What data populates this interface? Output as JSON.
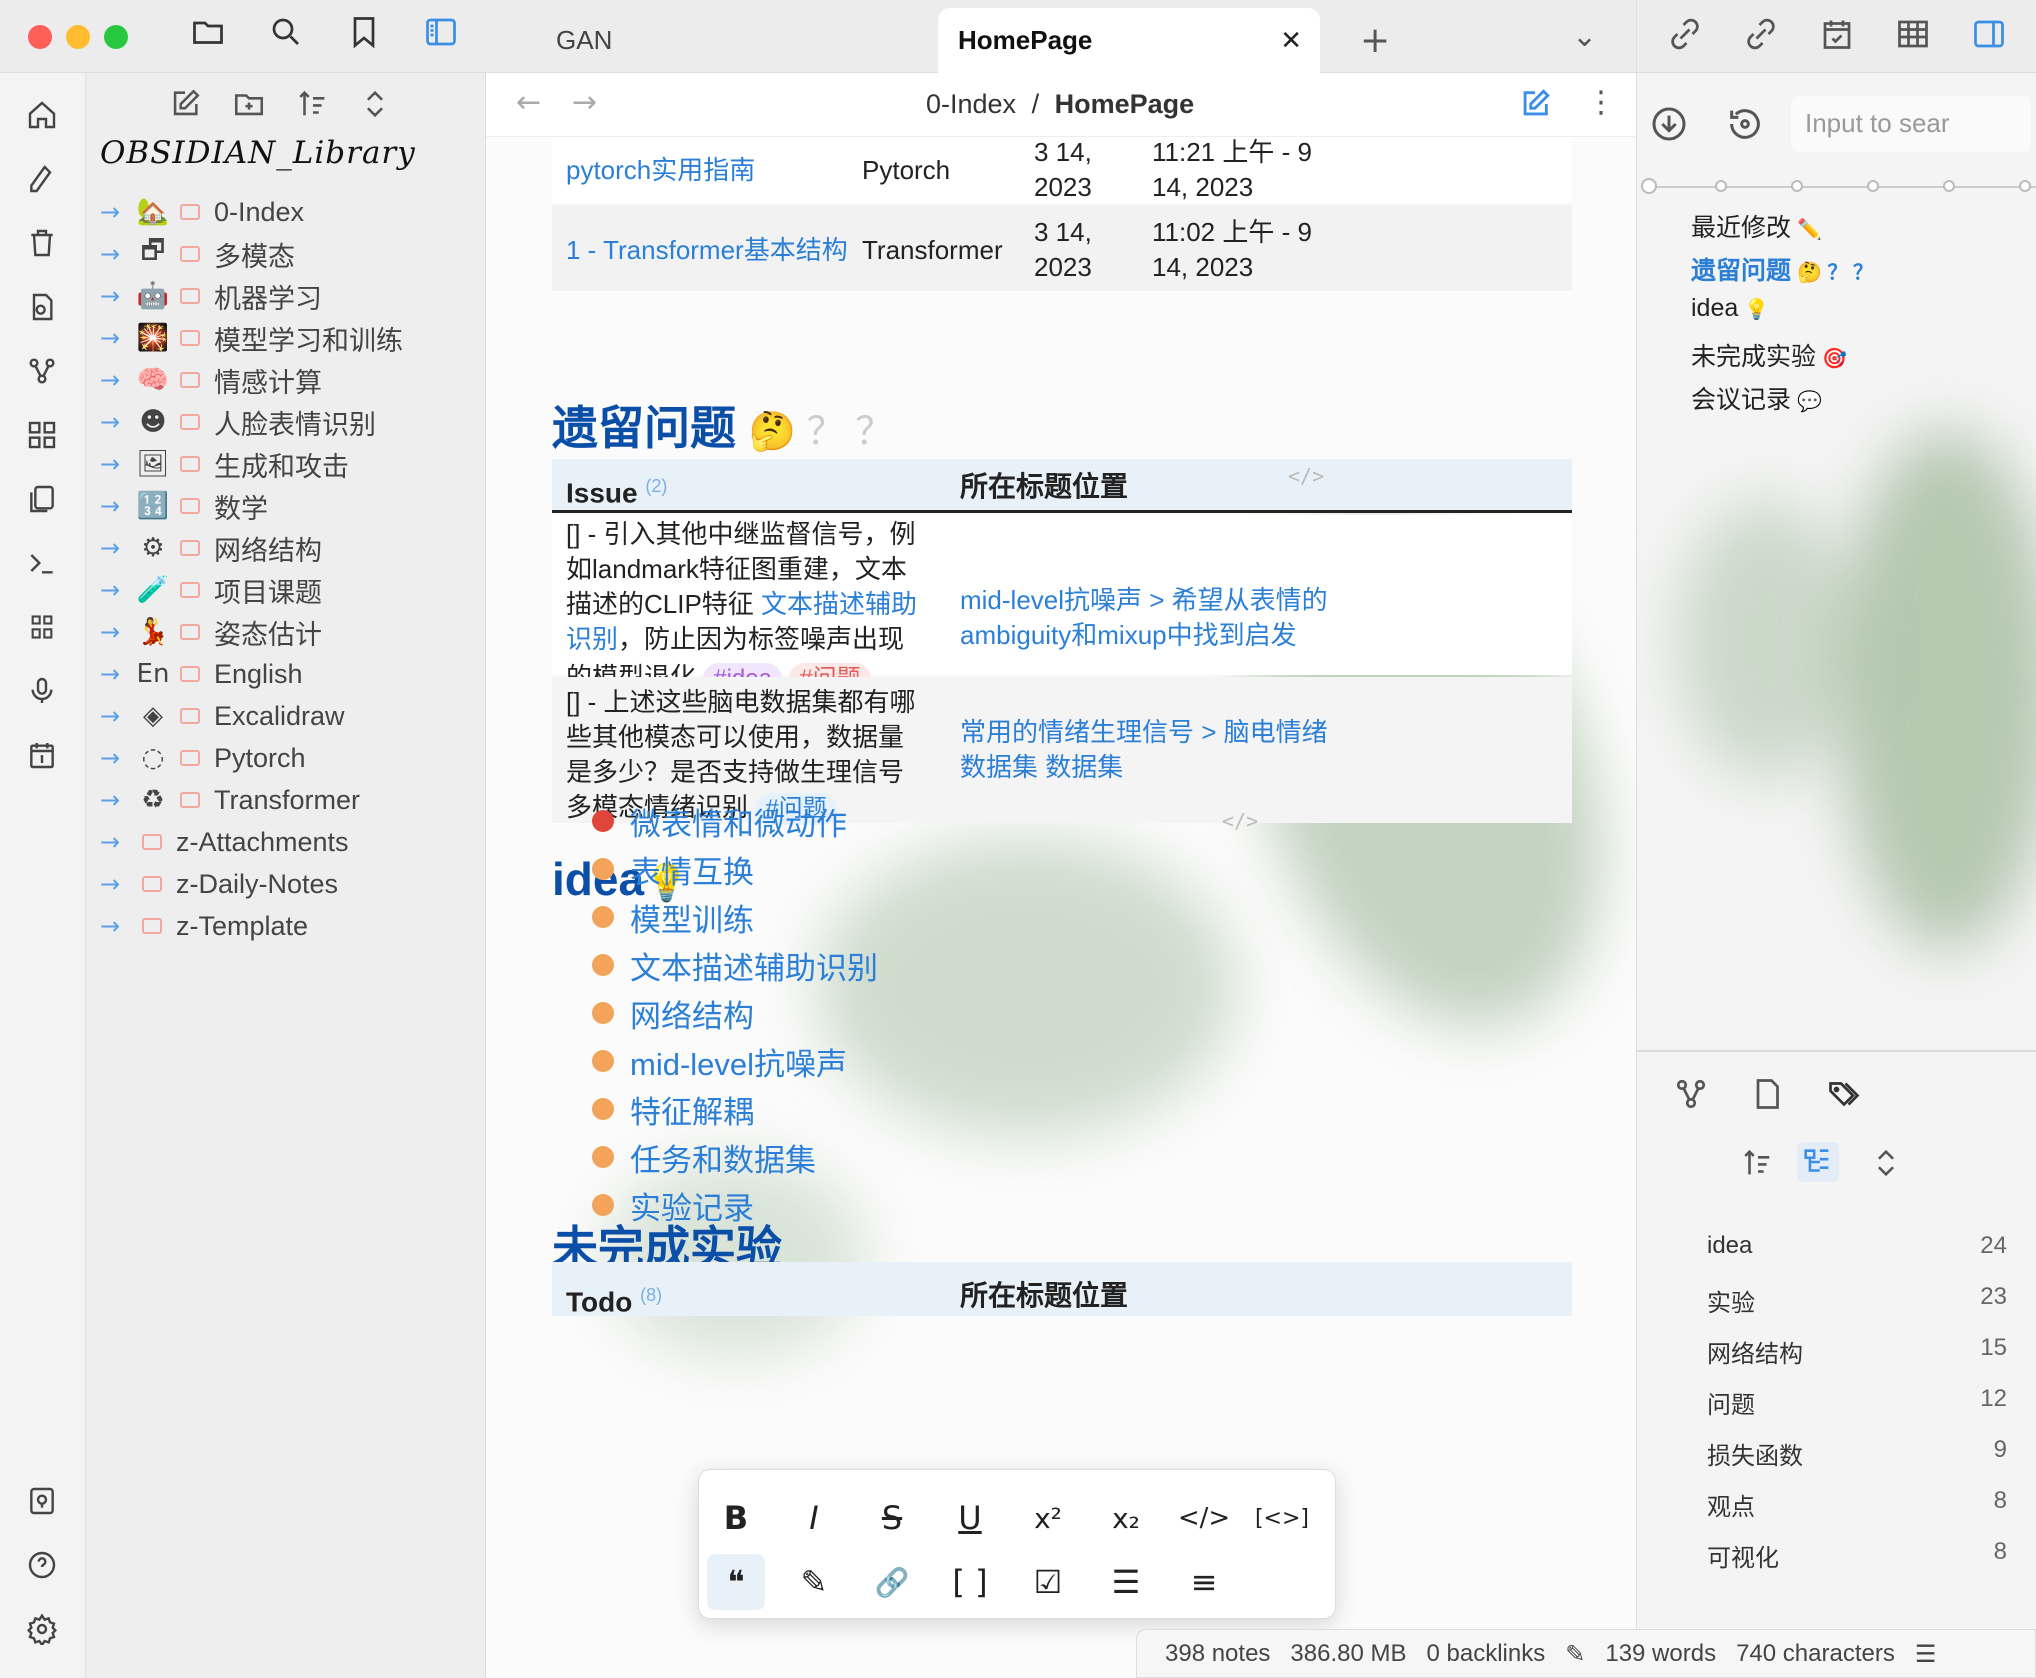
{
  "left_toolbar": {
    "icons": [
      "folder-icon",
      "search-icon",
      "bookmark-icon",
      "sidebar-toggle-icon"
    ],
    "file_actions": [
      "new-note-icon",
      "new-folder-icon",
      "sort-icon",
      "collapse-icon"
    ]
  },
  "ribbon": {
    "icons": [
      "home-icon",
      "pen-icon",
      "trash-icon",
      "file-search-icon",
      "graph-icon",
      "grid-icon",
      "pages-icon",
      "terminal-icon",
      "calendar-grid-icon",
      "mic-icon",
      "calendar-icon",
      "vault-icon",
      "help-icon",
      "settings-icon"
    ]
  },
  "vault_name": "OBSIDIAN_Library",
  "tree": [
    {
      "emoji": "🏡",
      "label": "0-Index"
    },
    {
      "emoji": "🗗",
      "label": "多模态"
    },
    {
      "emoji": "🤖",
      "label": "机器学习"
    },
    {
      "emoji": "🎇",
      "label": "模型学习和训练"
    },
    {
      "emoji": "🧠",
      "label": "情感计算"
    },
    {
      "emoji": "☻",
      "label": "人脸表情识别"
    },
    {
      "emoji": "🖼",
      "label": "生成和攻击"
    },
    {
      "emoji": "🔢",
      "label": "数学"
    },
    {
      "emoji": "⚙",
      "label": "网络结构"
    },
    {
      "emoji": "🧪",
      "label": "项目课题"
    },
    {
      "emoji": "💃",
      "label": "姿态估计"
    },
    {
      "emoji": "En",
      "label": "English"
    },
    {
      "emoji": "◈",
      "label": "Excalidraw"
    },
    {
      "emoji": "◌",
      "label": "Pytorch"
    },
    {
      "emoji": "♻",
      "label": "Transformer"
    },
    {
      "emoji": "",
      "label": "z-Attachments"
    },
    {
      "emoji": "",
      "label": "z-Daily-Notes"
    },
    {
      "emoji": "",
      "label": "z-Template"
    }
  ],
  "tabs": {
    "inactive": "GAN",
    "active": "HomePage",
    "close": "✕",
    "new": "+",
    "dropdown": "⌄"
  },
  "breadcrumb": {
    "parent": "0-Index",
    "sep": "/",
    "current": "HomePage",
    "back": "←",
    "forward": "→"
  },
  "recent_table": [
    {
      "title": "pytorch实用指南",
      "folder": "Pytorch",
      "created": "3 14, 2023",
      "modified": "11:21 上午 - 9 14, 2023"
    },
    {
      "title": "1 - Transformer基本结构",
      "folder": "Transformer",
      "created": "3 14, 2023",
      "modified": "11:02 上午 - 9 14, 2023"
    }
  ],
  "issues": {
    "heading": "遗留问题",
    "heading_emoji": "🤔 ？ ？",
    "col1": "Issue",
    "col1_count": "(2)",
    "col2": "所在标题位置",
    "code_icon": "</>",
    "rows": [
      {
        "text": "[] - 引入其他中继监督信号，例如landmark特征图重建，文本描述的CLIP特征 ",
        "link": "文本描述辅助识别",
        "text2": "，防止因为标签噪声出现的模型退化",
        "tag1": "#idea",
        "tag2": "#问题",
        "location": "mid-level抗噪声 > 希望从表情的ambiguity和mixup中找到启发"
      },
      {
        "text": "[] - 上述这些脑电数据集都有哪些其他模态可以使用，数据量是多少？是否支持做生理信号多模态情绪识别",
        "tag1": "#问题",
        "location": "常用的情绪生理信号 > 脑电情绪数据集 数据集"
      }
    ]
  },
  "idea": {
    "heading": "idea",
    "emoji": "💡",
    "code_icon": "</>",
    "items": [
      "微表情和微动作",
      "表情互换",
      "模型训练",
      "文本描述辅助识别",
      "网络结构",
      "mid-level抗噪声",
      "特征解耦",
      "任务和数据集",
      "实验记录"
    ]
  },
  "unfinished": {
    "heading": "未完成实验",
    "col1": "Todo",
    "col1_count": "(8)",
    "col2": "所在标题位置"
  },
  "format_toolbar": {
    "row1": [
      "B",
      "I",
      "S",
      "U",
      "x²",
      "x₂",
      "</>",
      "[<>]"
    ],
    "row2": [
      "❝",
      "✎",
      "🔗",
      "[ ]",
      "☑",
      "☰",
      "≡"
    ]
  },
  "right_pane": {
    "search_placeholder": "Input to sear",
    "outline": [
      {
        "label": "最近修改",
        "emoji": "✏️"
      },
      {
        "label": "遗留问题",
        "emoji": "🤔 ？ ？"
      },
      {
        "label": "idea",
        "emoji": "💡"
      },
      {
        "label": "未完成实验",
        "emoji": "🎯"
      },
      {
        "label": "会议记录",
        "emoji": "💬"
      }
    ],
    "tags": [
      {
        "name": "idea",
        "count": "24"
      },
      {
        "name": "实验",
        "count": "23"
      },
      {
        "name": "网络结构",
        "count": "15"
      },
      {
        "name": "问题",
        "count": "12"
      },
      {
        "name": "损失函数",
        "count": "9"
      },
      {
        "name": "观点",
        "count": "8"
      },
      {
        "name": "可视化",
        "count": "8"
      }
    ]
  },
  "status": {
    "notes": "398 notes",
    "size": "386.80 MB",
    "backlinks": "0 backlinks",
    "words": "139 words",
    "chars": "740 characters"
  },
  "colors": {
    "heading": "#0b4ea8",
    "link": "#2b7fd6",
    "tag_purple": "#a35ad8",
    "tag_red": "#e05c5c",
    "active_icon": "#3a8ee6"
  }
}
